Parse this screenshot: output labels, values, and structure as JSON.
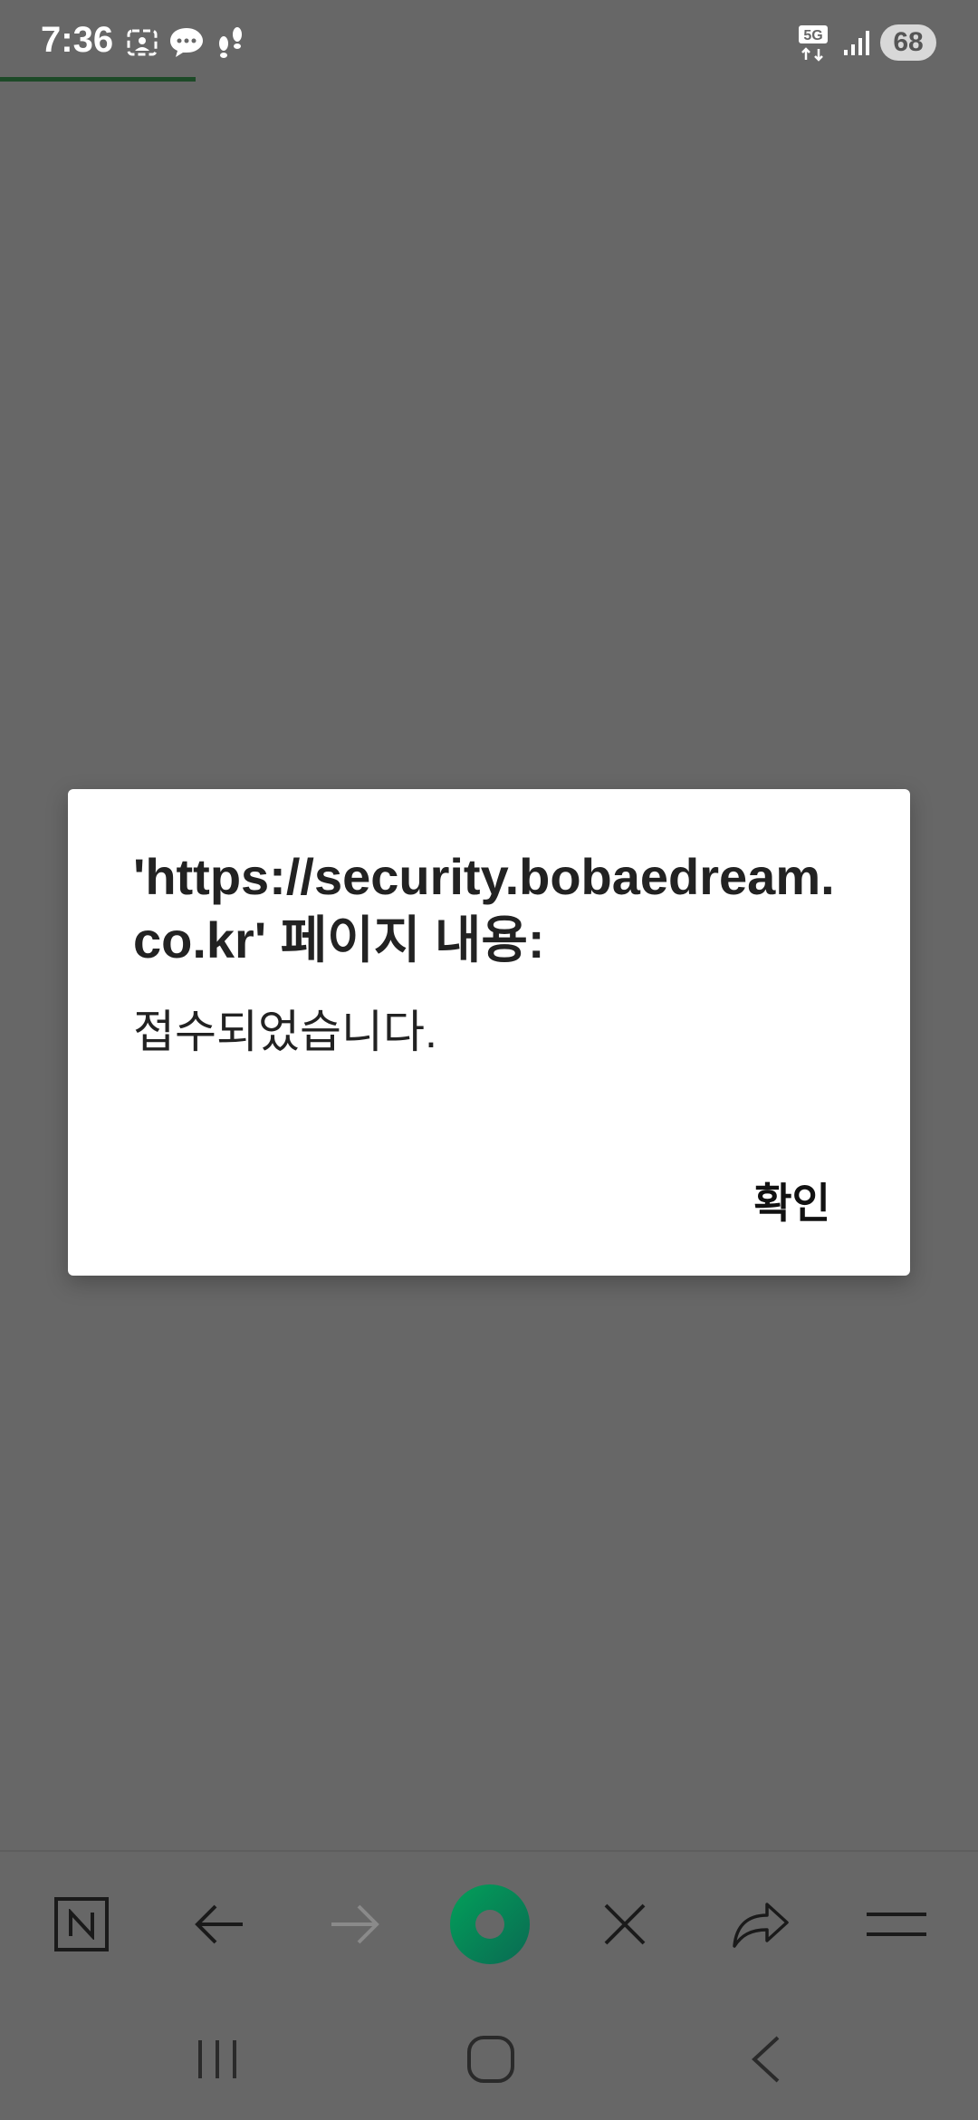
{
  "status_bar": {
    "time": "7:36",
    "network": "5G",
    "battery": "68",
    "icons": [
      "screenshot-icon",
      "chat-bubble-icon",
      "footprints-icon",
      "signal-icon"
    ]
  },
  "dialog": {
    "title": "'https://security.bobaedream.co.kr' 페이지 내용:",
    "message": "접수되었습니다.",
    "ok_label": "확인"
  },
  "toolbar": {
    "icons": [
      "naver-n-icon",
      "back-arrow-icon",
      "forward-arrow-icon",
      "home-circle-icon",
      "close-icon",
      "share-icon",
      "menu-icon"
    ]
  },
  "navbar": {
    "icons": [
      "recent-apps-icon",
      "home-icon",
      "back-icon"
    ]
  }
}
